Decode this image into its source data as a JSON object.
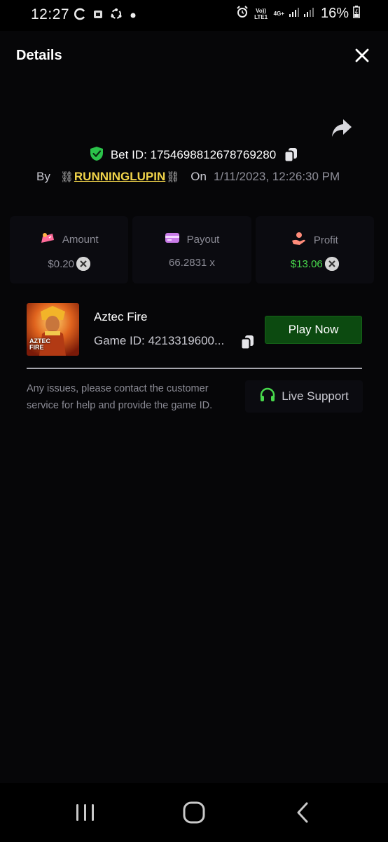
{
  "status_bar": {
    "time": "12:27",
    "battery_percent": "16%",
    "network_label_top": "Vo)) LTE1",
    "network_type": "4G+",
    "icons": [
      "sync-icon",
      "app-notification-icon",
      "recycle-icon",
      "dot-icon",
      "alarm-icon",
      "signal-icon",
      "battery-icon"
    ]
  },
  "modal": {
    "title": "Details",
    "bet_id": "Bet ID: 1754698812678769280",
    "by_label": "By",
    "user_chain_left": "⛓",
    "username": "RUNNINGLUPIN",
    "user_chain_right": "⛓",
    "on_label": "On",
    "date": "1/11/2023, 12:26:30 PM",
    "stats": [
      {
        "label": "Amount",
        "value": "$0.20",
        "icon": "amount-icon",
        "value_color": "#8b8b95",
        "has_coin": true
      },
      {
        "label": "Payout",
        "value": "66.2831 x",
        "icon": "payout-card-icon",
        "value_color": "#8b8b95",
        "has_coin": false
      },
      {
        "label": "Profit",
        "value": "$13.06",
        "icon": "profit-hand-icon",
        "value_color": "#48d84c",
        "has_coin": true
      }
    ],
    "game": {
      "name": "Aztec Fire",
      "game_id": "Game ID: 4213319600...",
      "thumb_text_line1": "AZTEC",
      "thumb_text_line2": "FIRE",
      "play_label": "Play Now"
    },
    "help_text": "Any issues, please contact the customer service for help and provide the game ID.",
    "live_support_label": "Live Support"
  },
  "colors": {
    "accent_green": "#0c4a10",
    "profit_green": "#48d84c",
    "username_yellow": "#f1d44a",
    "verified_green": "#2bc24a",
    "amount_pink": "#ff6b9a",
    "payout_purple": "#c97be8",
    "profit_salmon": "#ff8c7a"
  }
}
